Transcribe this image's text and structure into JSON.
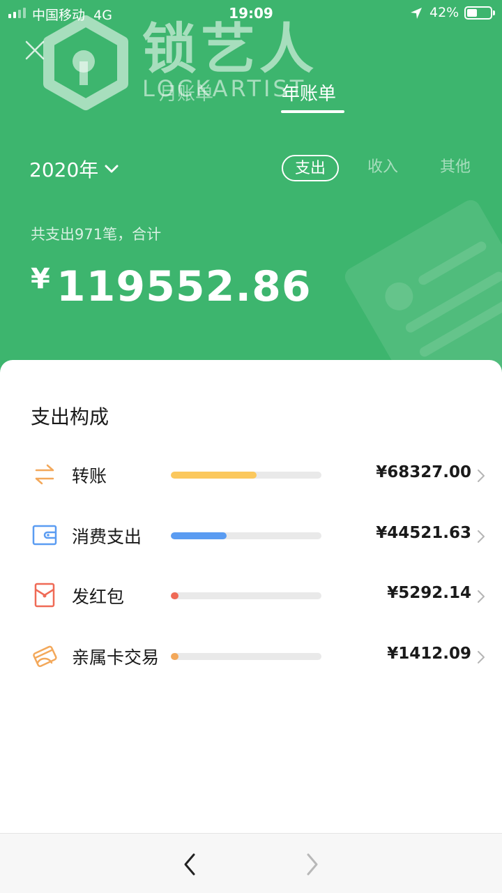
{
  "status_bar": {
    "carrier": "中国移动",
    "network": "4G",
    "time": "19:09",
    "battery": "42%"
  },
  "watermark": {
    "title": "锁艺人",
    "subtitle": "LOCKARTIST"
  },
  "header": {
    "tabs": [
      {
        "label": "月账单",
        "active": false
      },
      {
        "label": "年账单",
        "active": true
      }
    ]
  },
  "filters": {
    "year": "2020年",
    "types": [
      {
        "label": "支出",
        "active": true
      },
      {
        "label": "收入",
        "active": false
      },
      {
        "label": "其他",
        "active": false
      }
    ]
  },
  "summary": {
    "text": "共支出971笔，合计",
    "currency": "¥",
    "total": "119552.86"
  },
  "breakdown": {
    "title": "支出构成",
    "items": [
      {
        "label": "转账",
        "amount": "¥68327.00",
        "share": 0.5715,
        "color": "#fbc85d",
        "icon": "transfer-icon"
      },
      {
        "label": "消费支出",
        "amount": "¥44521.63",
        "share": 0.3724,
        "color": "#5a9cf2",
        "icon": "wallet-icon"
      },
      {
        "label": "发红包",
        "amount": "¥5292.14",
        "share": 0.0443,
        "color": "#ef6a56",
        "icon": "red-packet-icon"
      },
      {
        "label": "亲属卡交易",
        "amount": "¥1412.09",
        "share": 0.0118,
        "color": "#f3a85a",
        "icon": "family-card-icon"
      }
    ]
  },
  "colors": {
    "brand_green": "#3db56e"
  }
}
